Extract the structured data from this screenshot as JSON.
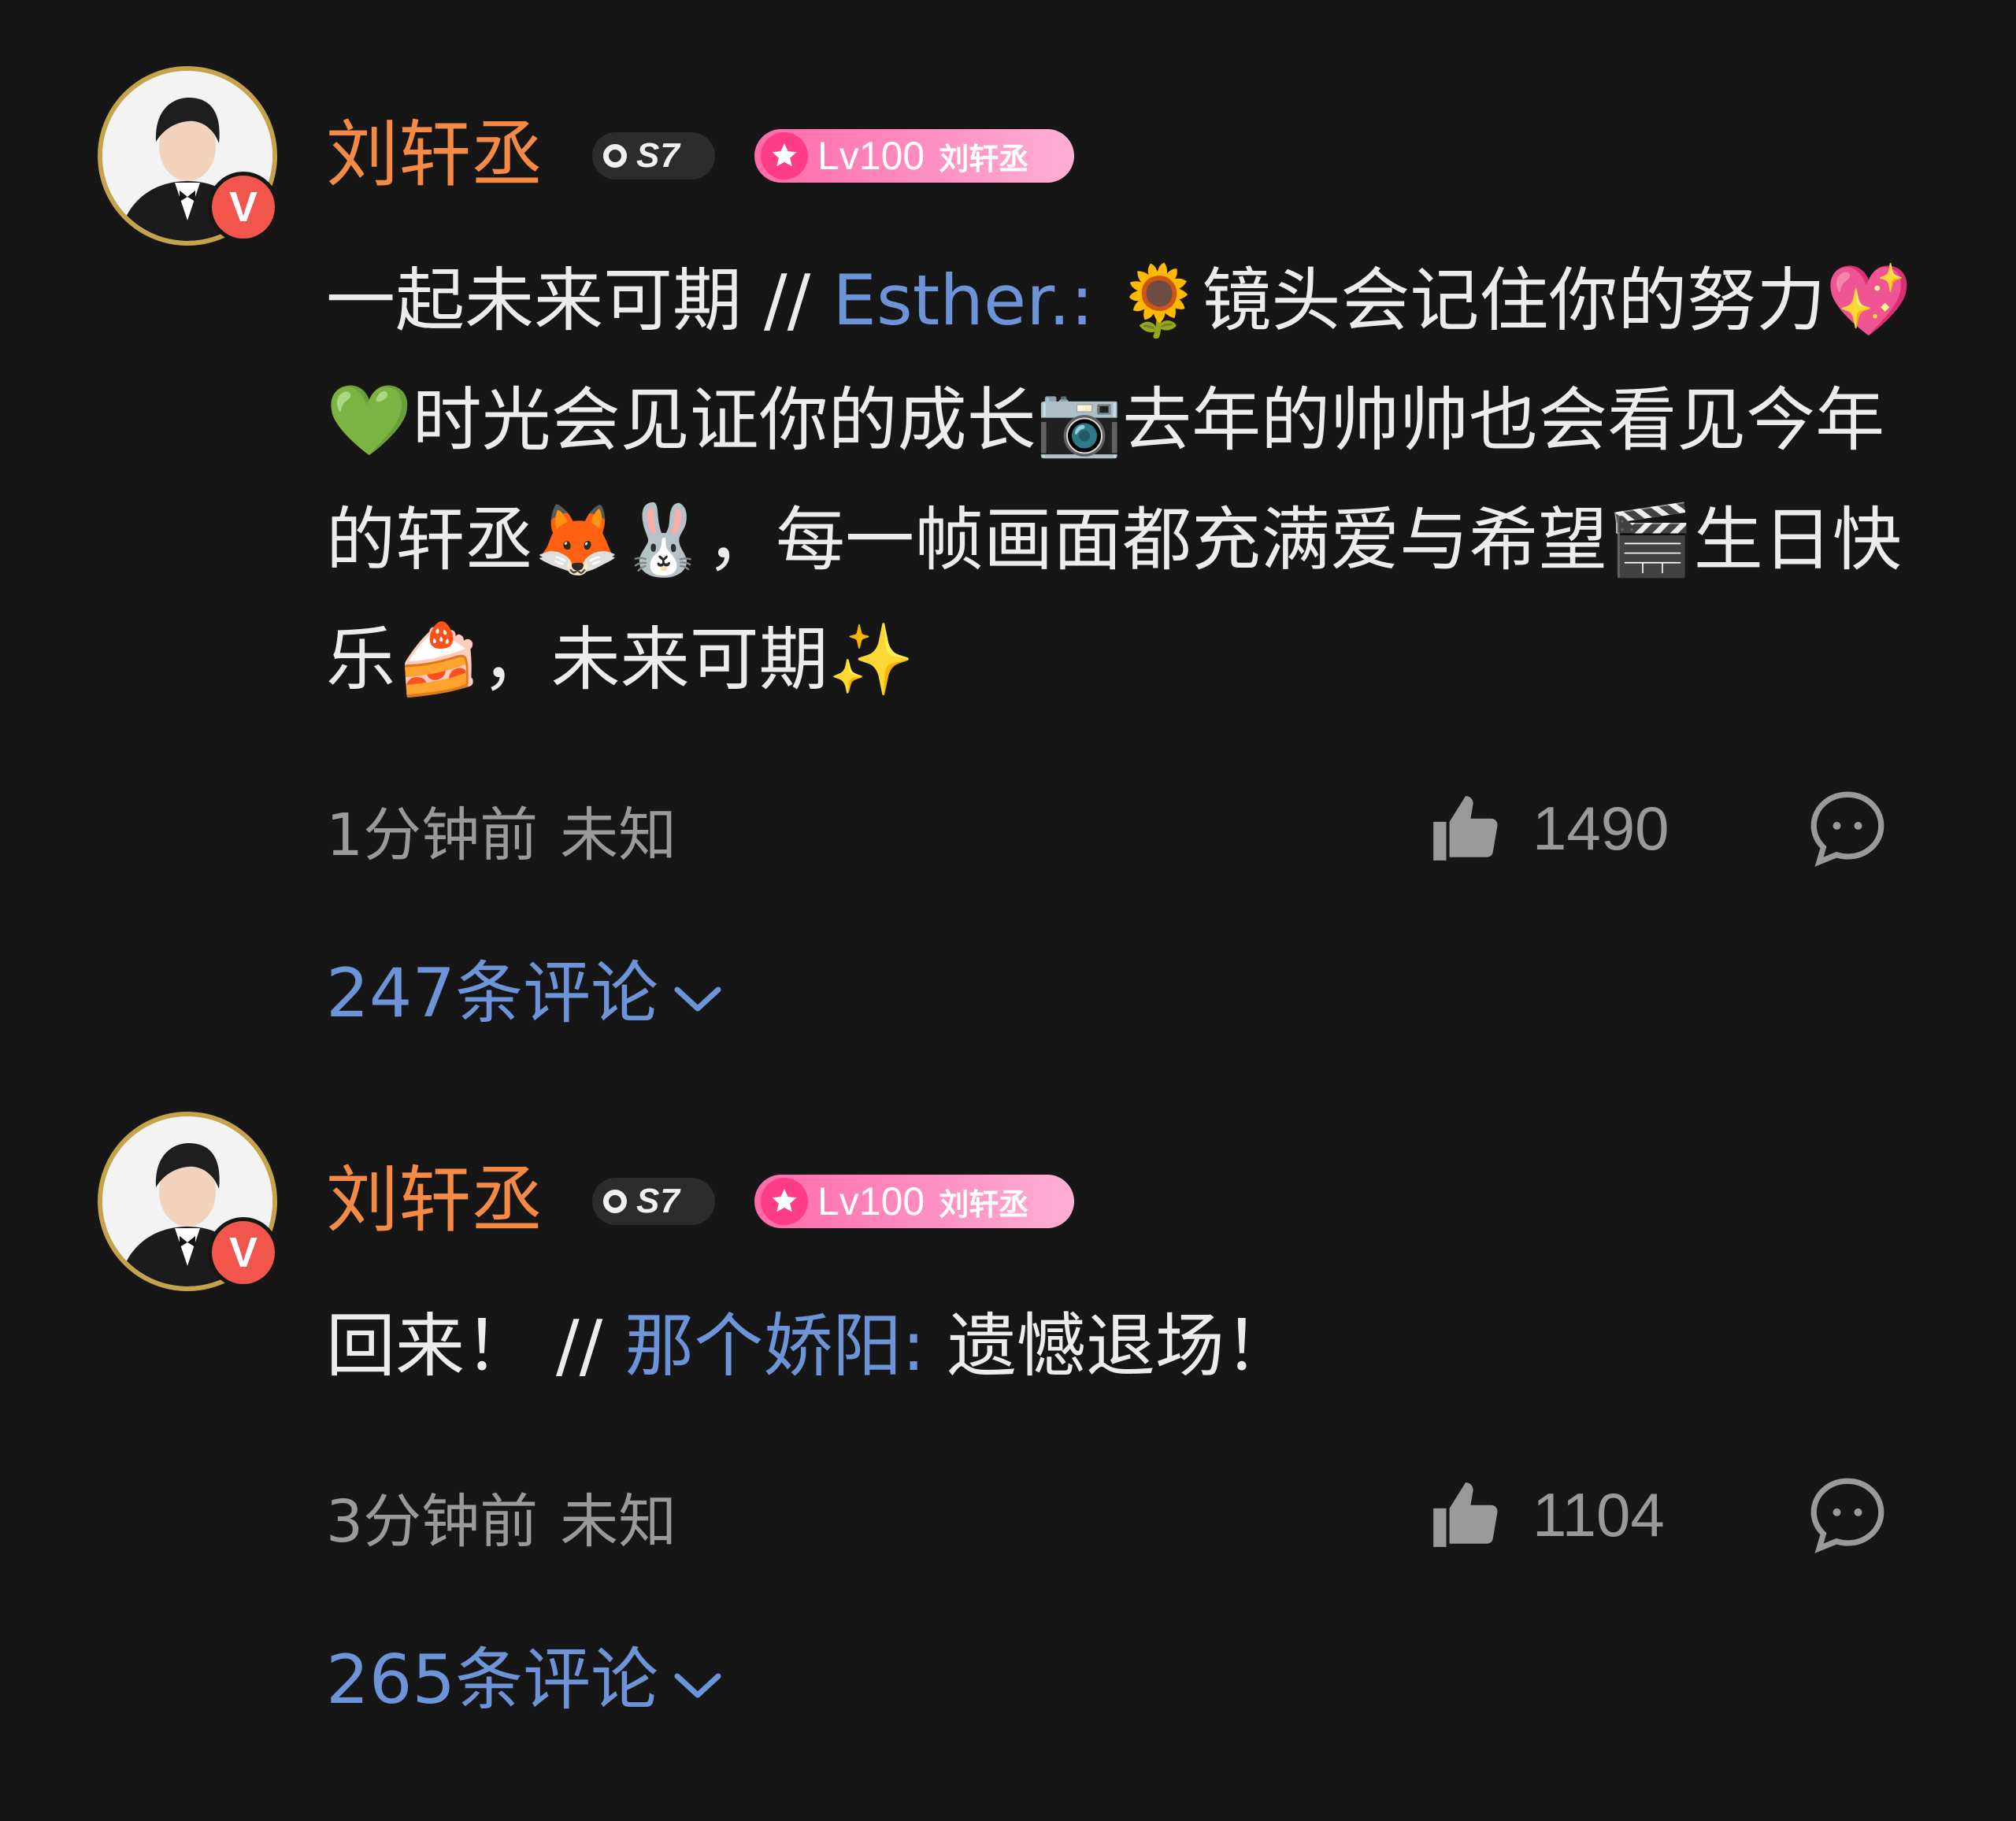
{
  "comments": [
    {
      "username": "刘轩丞",
      "svip_label": "S7",
      "level_label": "Lv100",
      "level_name": "刘轩丞",
      "verified_mark": "V",
      "text_main": "一起未来可期",
      "separator": "//",
      "mention": "Esther.:",
      "text_repost": "🌻镜头会记住你的努力💖💚时光会见证你的成长📷去年的帅帅也会看见今年的轩丞🦊🐰，每一帧画面都充满爱与希望🎬生日快乐🍰，未来可期✨",
      "time": "1分钟前",
      "location": "未知",
      "likes": "1490",
      "replies_label": "247条评论"
    },
    {
      "username": "刘轩丞",
      "svip_label": "S7",
      "level_label": "Lv100",
      "level_name": "刘轩丞",
      "verified_mark": "V",
      "text_main": "回来！",
      "separator": "//",
      "mention": "那个娇阳:",
      "text_repost": "遗憾退场！",
      "time": "3分钟前",
      "location": "未知",
      "likes": "1104",
      "replies_label": "265条评论"
    }
  ],
  "colors": {
    "background": "#161616",
    "username": "#f58a46",
    "link": "#6d93d8",
    "meta": "#9a9a9a",
    "text": "#ececec",
    "verified": "#f2554b",
    "level_badge": "#ff6aa8"
  },
  "icons": [
    "verified-icon",
    "svip-icon",
    "level-star-icon",
    "thumbs-up-icon",
    "reply-bubble-icon",
    "chevron-down-icon"
  ]
}
